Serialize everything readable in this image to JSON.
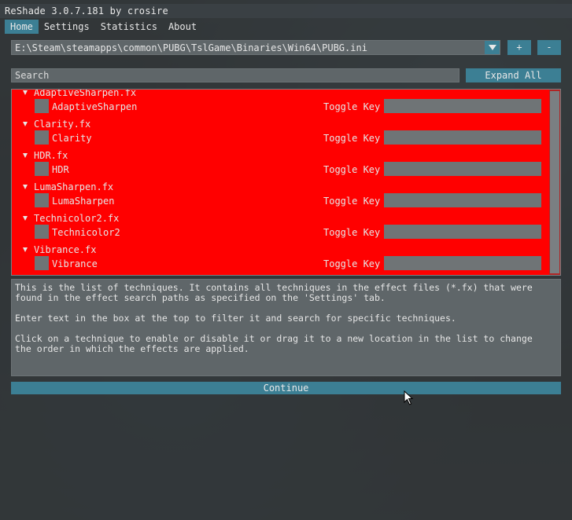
{
  "window": {
    "title": "ReShade 3.0.7.181 by crosire"
  },
  "menu": {
    "items": [
      {
        "label": "Home",
        "active": true
      },
      {
        "label": "Settings",
        "active": false
      },
      {
        "label": "Statistics",
        "active": false
      },
      {
        "label": "About",
        "active": false
      }
    ]
  },
  "preset": {
    "path": "E:\\Steam\\steamapps\\common\\PUBG\\TslGame\\Binaries\\Win64\\PUBG.ini",
    "add_label": "+",
    "remove_label": "-"
  },
  "search": {
    "placeholder": "Search"
  },
  "expand_all_label": "Expand All",
  "techniques": [
    {
      "file": "AdaptiveSharpen.fx",
      "name": "AdaptiveSharpen",
      "toggle_label": "Toggle Key",
      "toggle_value": ""
    },
    {
      "file": "Clarity.fx",
      "name": "Clarity",
      "toggle_label": "Toggle Key",
      "toggle_value": ""
    },
    {
      "file": "HDR.fx",
      "name": "HDR",
      "toggle_label": "Toggle Key",
      "toggle_value": ""
    },
    {
      "file": "LumaSharpen.fx",
      "name": "LumaSharpen",
      "toggle_label": "Toggle Key",
      "toggle_value": ""
    },
    {
      "file": "Technicolor2.fx",
      "name": "Technicolor2",
      "toggle_label": "Toggle Key",
      "toggle_value": ""
    },
    {
      "file": "Vibrance.fx",
      "name": "Vibrance",
      "toggle_label": "Toggle Key",
      "toggle_value": ""
    }
  ],
  "description": "This is the list of techniques. It contains all techniques in the effect files (*.fx) that were\nfound in the effect search paths as specified on the 'Settings' tab.\n\nEnter text in the box at the top to filter it and search for specific techniques.\n\nClick on a technique to enable or disable it or drag it to a new location in the list to change\nthe order in which the effects are applied.",
  "continue_label": "Continue",
  "colors": {
    "accent": "#3c7f94",
    "list_background": "#ff0000",
    "field": "#5f6669"
  }
}
